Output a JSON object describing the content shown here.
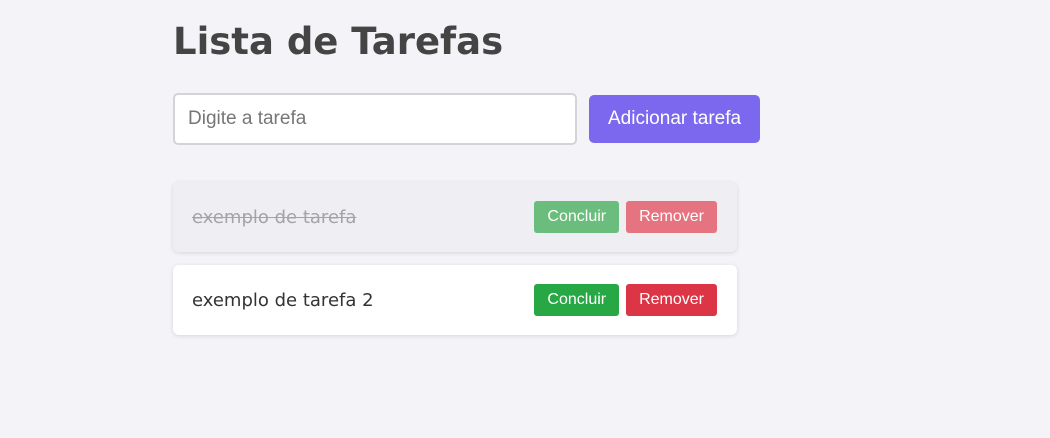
{
  "page": {
    "title": "Lista de Tarefas"
  },
  "add_form": {
    "input_placeholder": "Digite a tarefa",
    "input_value": "",
    "button_label": "Adicionar tarefa"
  },
  "tasks": [
    {
      "text": "exemplo de tarefa",
      "completed": true,
      "complete_label": "Concluir",
      "remove_label": "Remover"
    },
    {
      "text": "exemplo de tarefa 2",
      "completed": false,
      "complete_label": "Concluir",
      "remove_label": "Remover"
    }
  ],
  "colors": {
    "background": "#f3f3f8",
    "accent": "#7b68ee",
    "complete": "#28a745",
    "remove": "#dc3545"
  }
}
